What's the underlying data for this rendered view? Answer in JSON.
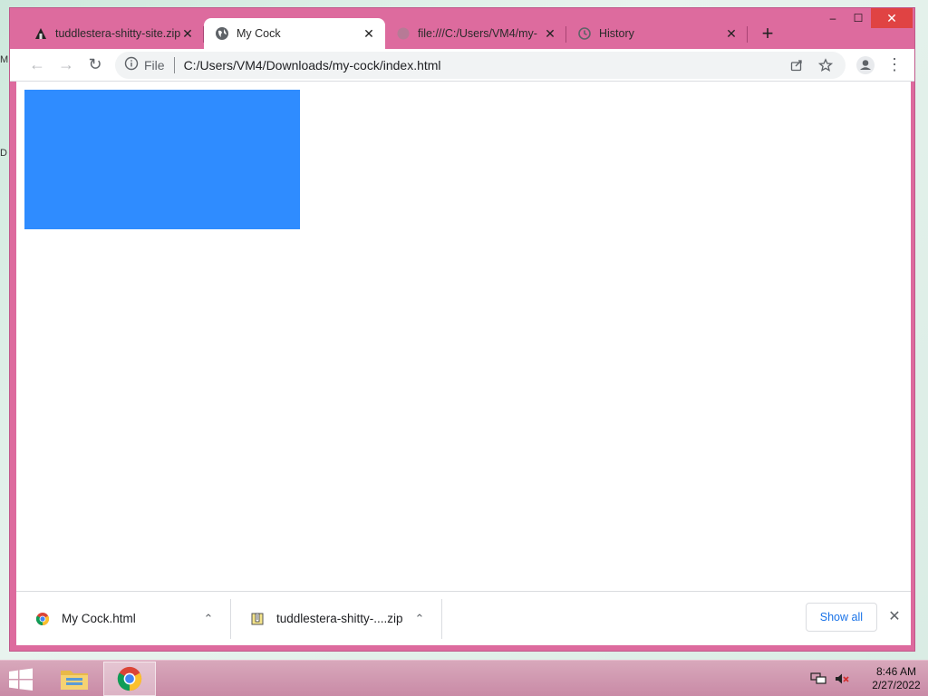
{
  "desktop": {
    "edge_labels": [
      "M",
      "D"
    ]
  },
  "window": {
    "controls": {
      "minimize": "–",
      "maximize": "☐",
      "close": "✕"
    }
  },
  "tabs": [
    {
      "title": "tuddlestera-shitty-site.zip",
      "close": "✕",
      "icon": "zip-favicon"
    },
    {
      "title": "My Cock",
      "close": "✕",
      "icon": "globe-icon",
      "active": true
    },
    {
      "title": "file:///C:/Users/VM4/my-",
      "close": "✕",
      "icon": "file-favicon"
    },
    {
      "title": "History",
      "close": "✕",
      "icon": "history-icon"
    }
  ],
  "new_tab_label": "+",
  "toolbar": {
    "back": "←",
    "forward": "→",
    "reload": "↻",
    "scheme_label": "File",
    "url": "C:/Users/VM4/Downloads/my-cock/index.html",
    "menu": "⋮"
  },
  "page": {
    "rect_color": "#2f8cff"
  },
  "downloads": {
    "items": [
      {
        "name": "My Cock.html",
        "chevron": "⌃"
      },
      {
        "name": "tuddlestera-shitty-....zip",
        "chevron": "⌃"
      }
    ],
    "show_all": "Show all",
    "close": "✕"
  },
  "taskbar": {
    "time": "8:46 AM",
    "date": "2/27/2022"
  },
  "colors": {
    "frame": "#dd6b9e",
    "accent_link": "#1a73e8",
    "taskbar": "#c98aa6"
  }
}
